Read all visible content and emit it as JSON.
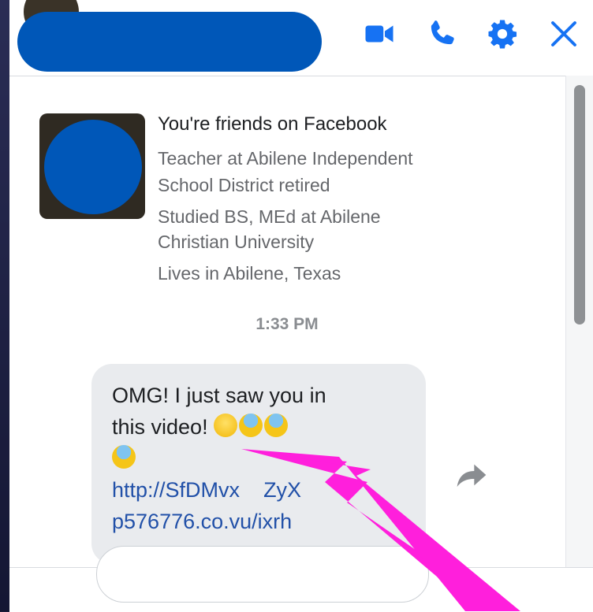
{
  "header": {
    "icons": [
      {
        "name": "video-camera-icon"
      },
      {
        "name": "phone-icon"
      },
      {
        "name": "gear-icon"
      },
      {
        "name": "close-icon"
      }
    ],
    "accent_color": "#1672f3"
  },
  "profile": {
    "title": "You're friends on Facebook",
    "lines": [
      "Teacher at Abilene Independent",
      "School District retired",
      "Studied BS, MEd at Abilene",
      "Christian University",
      "Lives in Abilene, Texas"
    ]
  },
  "conversation": {
    "timestamp": "1:33 PM",
    "message": {
      "text_line1": "OMG! I just saw you in",
      "text_line2": "this video!",
      "emojis": [
        "grinning-face",
        "face-screaming-in-fear",
        "face-screaming-in-fear",
        "face-screaming-in-fear"
      ],
      "link_line1": "http://SfDMvx",
      "link_line1_end": "ZyX",
      "link_line2": "p576776.co.vu/ixrh"
    }
  },
  "annotation": {
    "arrow_color": "#ff1fdc"
  }
}
